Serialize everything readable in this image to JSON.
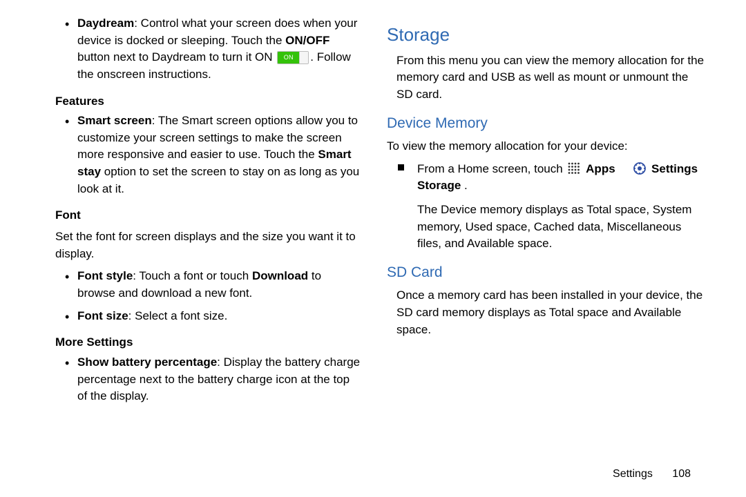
{
  "left": {
    "daydream": {
      "bold": "Daydream",
      "text1": ": Control what your screen does when your device is docked or sleeping. Touch the ",
      "onoff_bold": "ON/OFF",
      "text2": " button next to Daydream to turn it ON ",
      "toggle_label": "ON",
      "text3": ". Follow the onscreen instructions."
    },
    "features_hdr": "Features",
    "smart_screen": {
      "bold1": "Smart screen",
      "text1": ": The Smart screen options allow you to customize your screen settings to make the screen more responsive and easier to use. Touch the ",
      "bold2": "Smart stay",
      "text2": " option to set the screen to stay on as long as you look at it."
    },
    "font_hdr": "Font",
    "font_intro": "Set the font for screen displays and the size you want it to display.",
    "font_style": {
      "bold1": "Font style",
      "text1": ": Touch a font or touch ",
      "bold2": "Download",
      "text2": " to browse and download a new font."
    },
    "font_size": {
      "bold": "Font size",
      "text": ": Select a font size."
    },
    "more_hdr": "More Settings",
    "battery": {
      "bold": "Show battery percentage",
      "text": ": Display the battery charge percentage next to the battery charge icon at the top of the display."
    }
  },
  "right": {
    "storage_title": "Storage",
    "storage_intro": "From this menu you can view the memory allocation for the memory card and USB as well as mount or unmount the SD card.",
    "devmem_title": "Device Memory",
    "devmem_intro": "To view the memory allocation for your device:",
    "step1": {
      "pre": "From a Home screen, touch ",
      "apps_label": "Apps",
      "settings_label": "Settings",
      "arrow": " ",
      "storage_label": "Storage",
      "period": " ."
    },
    "devmem_body": "The Device memory displays as Total space, System memory, Used space, Cached data, Miscellaneous files, and Available space.",
    "sdcard_title": "SD Card",
    "sdcard_body": "Once a memory card has been installed in your device, the SD card memory displays as Total space and Available space.",
    "footer_section": "Settings",
    "footer_page": "108"
  }
}
